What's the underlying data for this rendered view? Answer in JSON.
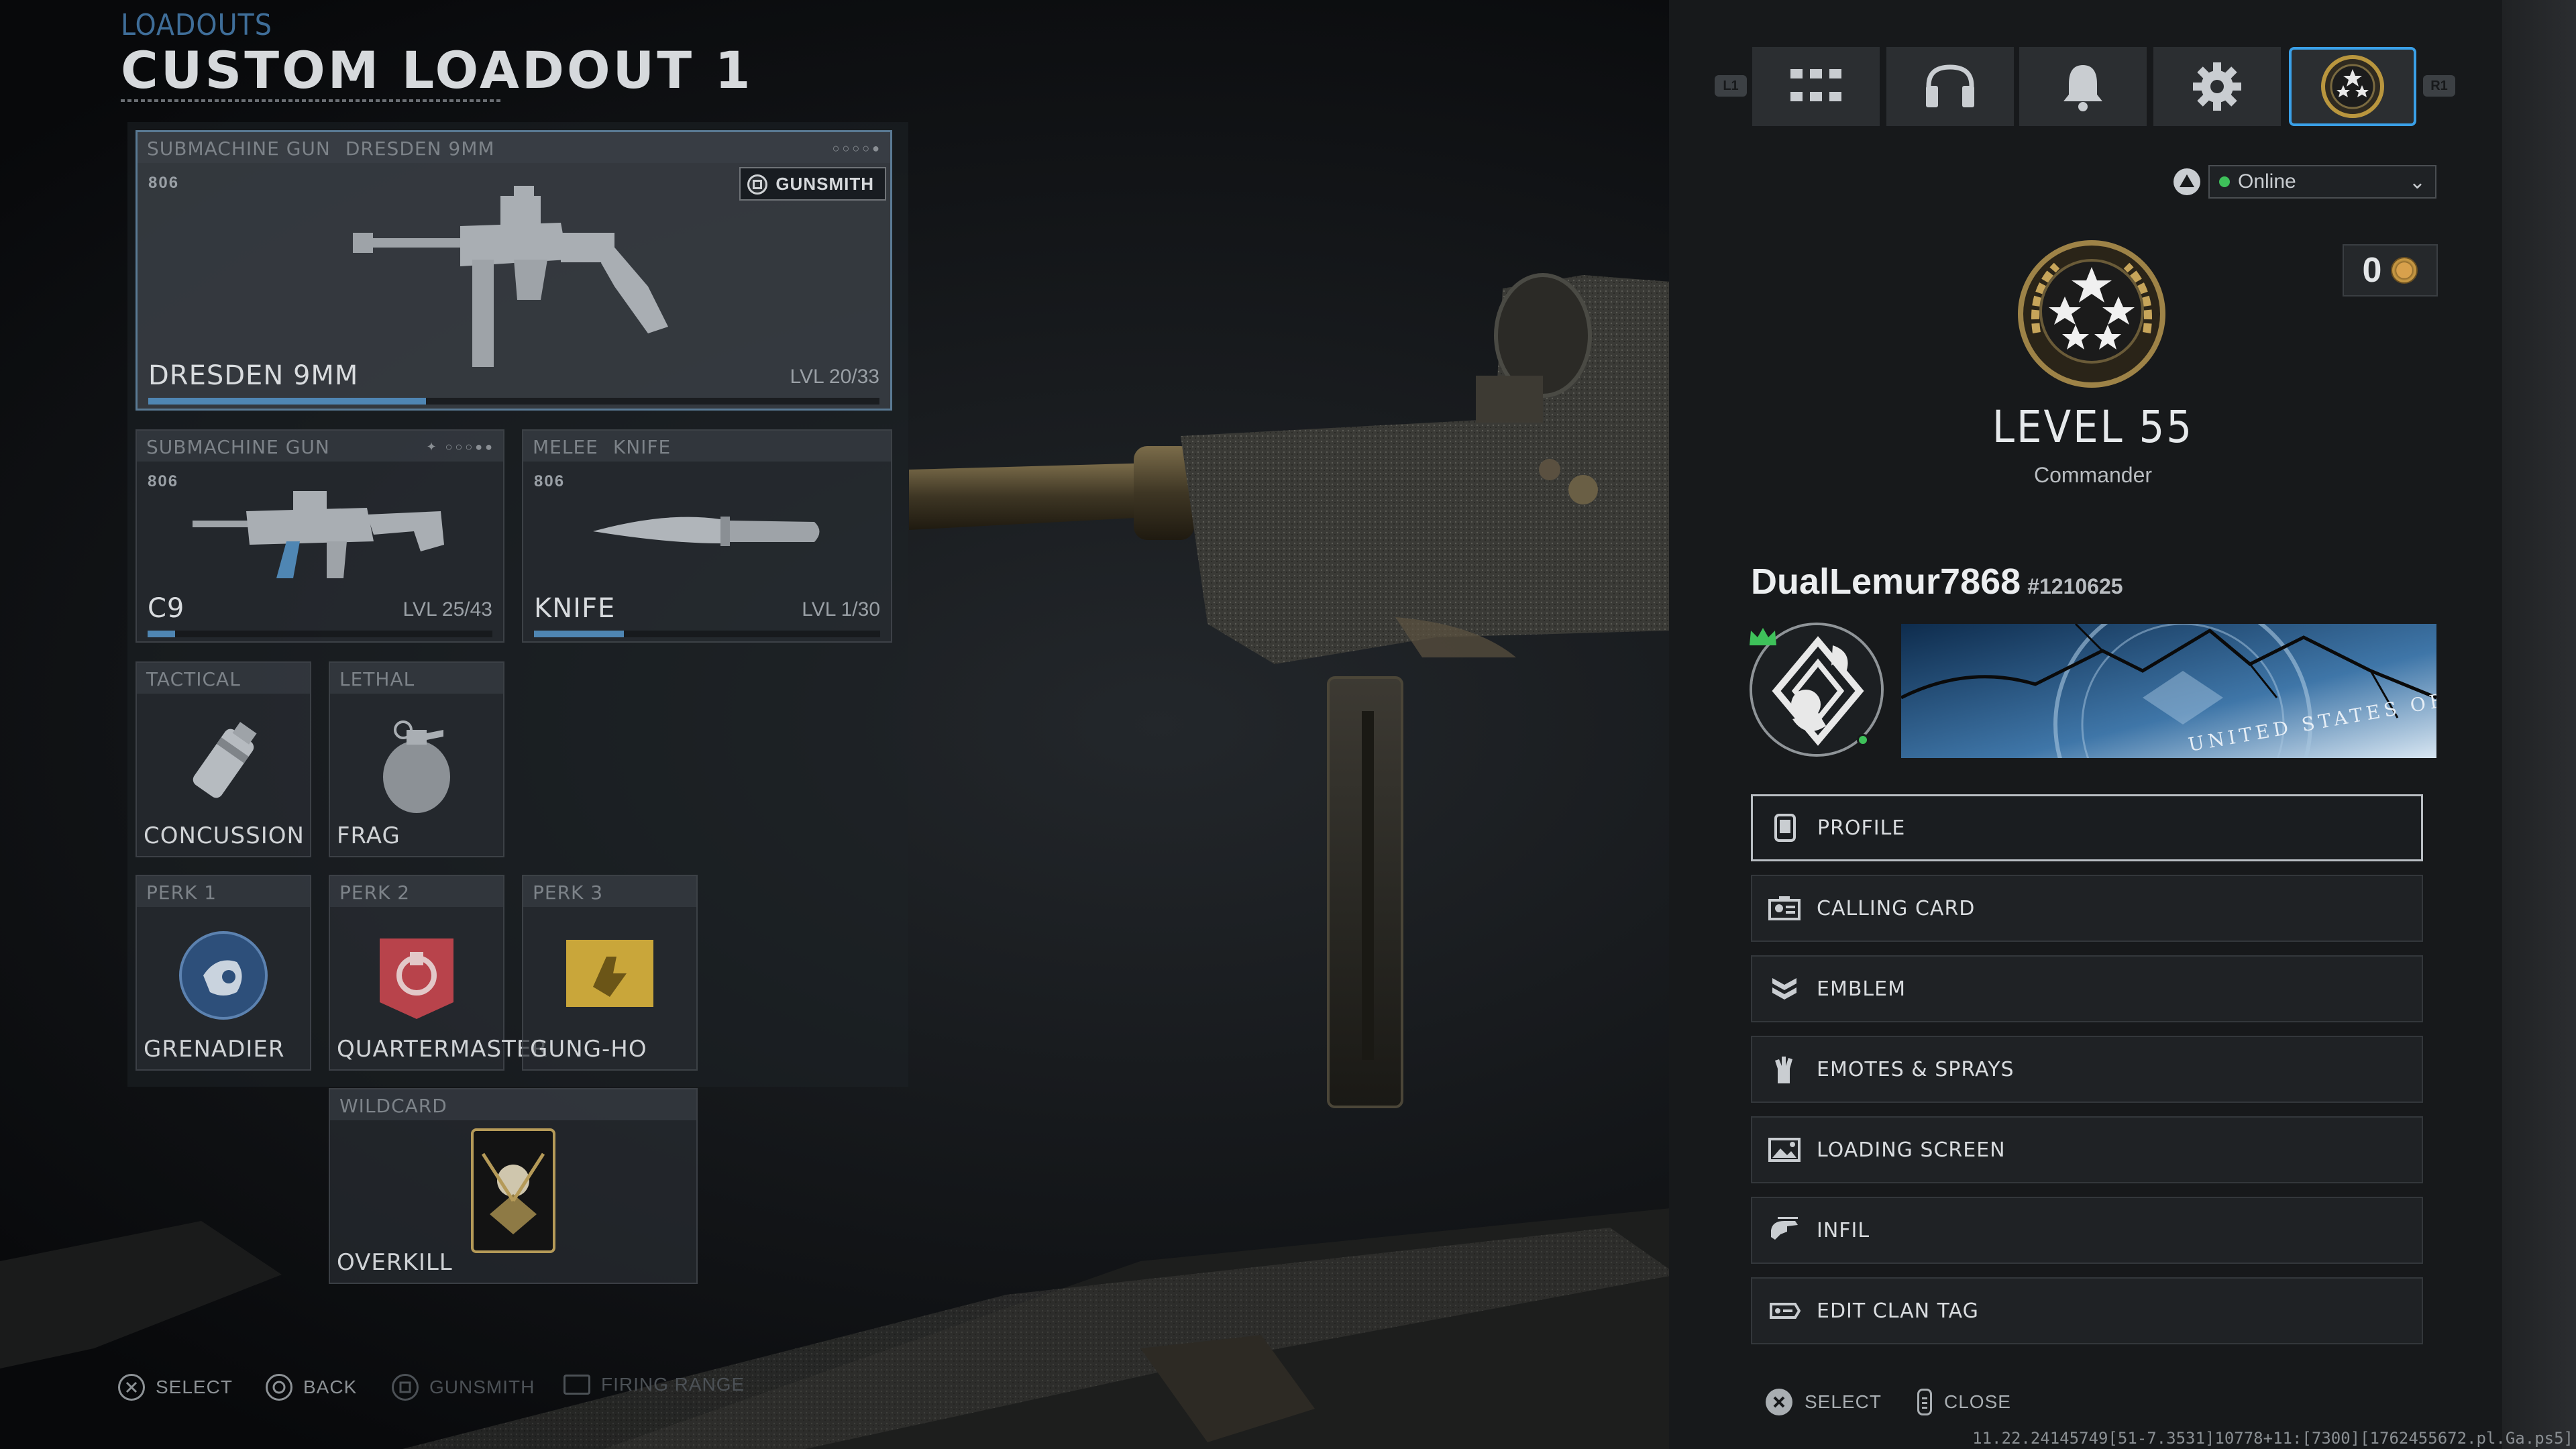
{
  "header": {
    "section": "LOADOUTS",
    "title": "CUSTOM LOADOUT 1"
  },
  "primary": {
    "category": "SUBMACHINE GUN",
    "weapon": "DRESDEN 9MM",
    "tag": "806",
    "gunsmith_label": "GUNSMITH",
    "name": "DRESDEN 9MM",
    "level": "LVL 20/33",
    "progress": 0.38
  },
  "secondary": {
    "category": "SUBMACHINE GUN",
    "tag": "806",
    "name": "C9",
    "level": "LVL 25/43",
    "progress": 0.08
  },
  "melee": {
    "category": "MELEE",
    "weapon": "KNIFE",
    "tag": "806",
    "name": "KNIFE",
    "level": "LVL 1/30",
    "progress": 0.26
  },
  "equipment": {
    "tactical": {
      "category": "TACTICAL",
      "name": "CONCUSSION"
    },
    "lethal": {
      "category": "LETHAL",
      "name": "FRAG"
    }
  },
  "perks": [
    {
      "category": "PERK 1",
      "name": "GRENADIER"
    },
    {
      "category": "PERK 2",
      "name": "QUARTERMASTER"
    },
    {
      "category": "PERK 3",
      "name": "GUNG-HO"
    }
  ],
  "wildcard": {
    "category": "WILDCARD",
    "name": "OVERKILL"
  },
  "footer_left": {
    "select": "SELECT",
    "back": "BACK",
    "gunsmith": "GUNSMITH",
    "firing_range": "FIRING RANGE"
  },
  "top_nav": {
    "left_bumper": "L1",
    "right_bumper": "R1",
    "tabs": [
      "grid-icon",
      "headset-icon",
      "bell-icon",
      "gear-icon",
      "rank-icon"
    ],
    "active_tab": "rank-icon"
  },
  "status": {
    "value": "Online",
    "color": "#3ec15a"
  },
  "currency": {
    "amount": "0",
    "icon": "cod-points-icon"
  },
  "rank": {
    "level": "LEVEL 55",
    "title": "Commander"
  },
  "player": {
    "gamertag": "DualLemur7868",
    "id": "#1210625"
  },
  "calling_card": {
    "text": "UNITED STATES OF AMERICA"
  },
  "menu": [
    {
      "label": "PROFILE",
      "icon": "phone-icon",
      "selected": true
    },
    {
      "label": "CALLING CARD",
      "icon": "calling-card-icon"
    },
    {
      "label": "EMBLEM",
      "icon": "emblem-icon"
    },
    {
      "label": "EMOTES & SPRAYS",
      "icon": "emote-icon"
    },
    {
      "label": "LOADING SCREEN",
      "icon": "loading-screen-icon"
    },
    {
      "label": "INFIL",
      "icon": "infil-icon"
    },
    {
      "label": "EDIT CLAN TAG",
      "icon": "clan-tag-icon"
    }
  ],
  "footer_right": {
    "select": "SELECT",
    "close": "CLOSE"
  },
  "debug_text": "11.22.24145749[51-7.3531]10778+11:[7300][1762455672.pl.Ga.ps5]",
  "colors": {
    "accent": "#3aa0e8",
    "xp": "#4f86b3",
    "online": "#3ec15a"
  }
}
